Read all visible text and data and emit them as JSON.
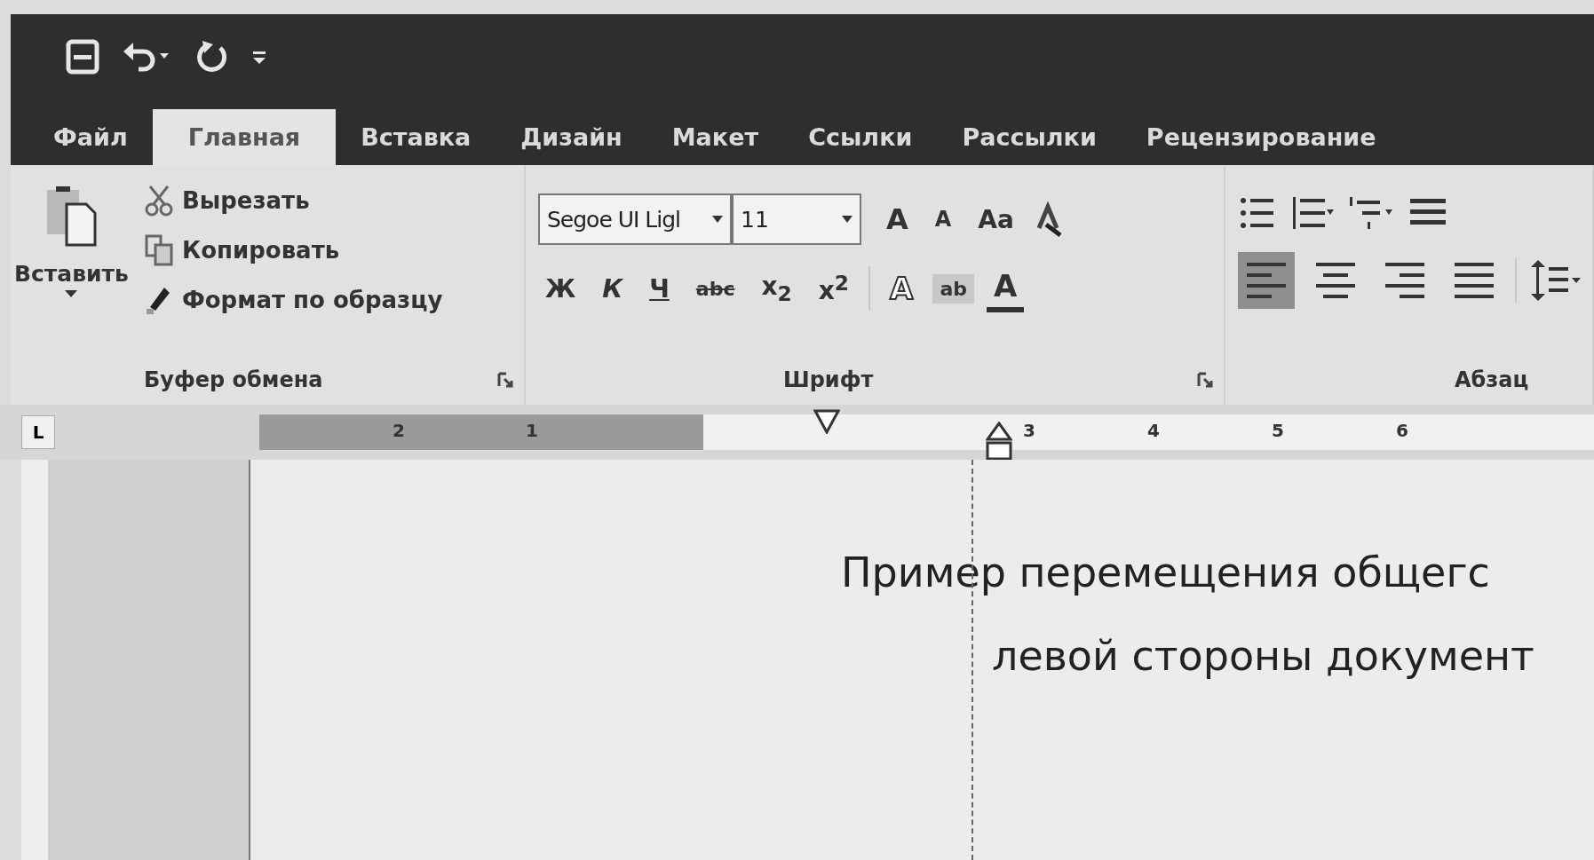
{
  "tabs": [
    {
      "label": "Файл",
      "selected": false
    },
    {
      "label": "Главная",
      "selected": true
    },
    {
      "label": "Вставка",
      "selected": false
    },
    {
      "label": "Дизайн",
      "selected": false
    },
    {
      "label": "Макет",
      "selected": false
    },
    {
      "label": "Ссылки",
      "selected": false
    },
    {
      "label": "Рассылки",
      "selected": false
    },
    {
      "label": "Рецензирование",
      "selected": false
    }
  ],
  "clipboard": {
    "paste": "Вставить",
    "items": [
      {
        "kind": "cut",
        "label": "Вырезать"
      },
      {
        "kind": "copy",
        "label": "Копировать"
      },
      {
        "kind": "format",
        "label": "Формат по образцу"
      }
    ],
    "group_label": "Буфер обмена"
  },
  "font": {
    "font_name": "Segoe UI Ligl",
    "font_size": "11",
    "row1": [
      {
        "kind": "grow",
        "label": "A"
      },
      {
        "kind": "shrink",
        "label": "A"
      },
      {
        "kind": "case",
        "label": "Aa"
      }
    ],
    "row2": [
      {
        "kind": "bold",
        "label": "Ж"
      },
      {
        "kind": "italic",
        "label": "К"
      },
      {
        "kind": "underline",
        "label": "Ч"
      },
      {
        "kind": "strike",
        "label": "abc"
      },
      {
        "kind": "sub",
        "label": "x$_{2}$"
      },
      {
        "kind": "sup",
        "label": "x$^{2}$"
      }
    ],
    "row2b": [
      {
        "kind": "effects",
        "label": "A"
      },
      {
        "kind": "highlight",
        "label": "ab"
      },
      {
        "kind": "color",
        "label": "A"
      }
    ],
    "group_label": "Шрифт"
  },
  "paragraph": {
    "alignment": [
      {
        "kind": "left",
        "selected": true
      },
      {
        "kind": "center",
        "selected": false
      },
      {
        "kind": "right",
        "selected": false
      },
      {
        "kind": "justify",
        "selected": false
      }
    ],
    "group_label": "Абзац"
  },
  "ruler": {
    "tab_selector": "L",
    "numbers": [
      "2",
      "1",
      "3",
      "4",
      "5",
      "6"
    ]
  },
  "document": {
    "lines": [
      "Пример перемещения общегс",
      "левой стороны документ"
    ]
  }
}
